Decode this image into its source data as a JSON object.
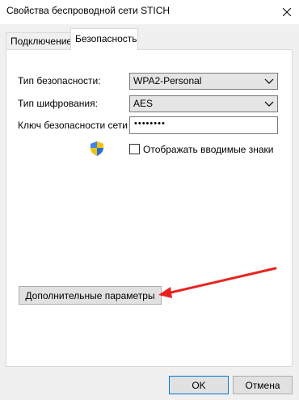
{
  "window": {
    "title": "Свойства беспроводной сети STICH"
  },
  "tabs": [
    {
      "label": "Подключение",
      "active": false
    },
    {
      "label": "Безопасность",
      "active": true
    }
  ],
  "security": {
    "security_type_label": "Тип безопасности:",
    "security_type_value": "WPA2-Personal",
    "encryption_type_label": "Тип шифрования:",
    "encryption_type_value": "AES",
    "key_label": "Ключ безопасности сети",
    "key_value": "••••••••",
    "show_chars_label": "Отображать вводимые знаки",
    "show_chars_checked": false
  },
  "buttons": {
    "advanced": "Дополнительные параметры",
    "ok": "OK",
    "cancel": "Отмена"
  },
  "icons": {
    "close": "close-icon",
    "dropdown": "chevron-down-icon",
    "shield": "uac-shield-icon",
    "annotation": "red-arrow-annotation"
  },
  "colors": {
    "annotation_arrow": "#e8231f",
    "ok_border": "#0078d7"
  }
}
